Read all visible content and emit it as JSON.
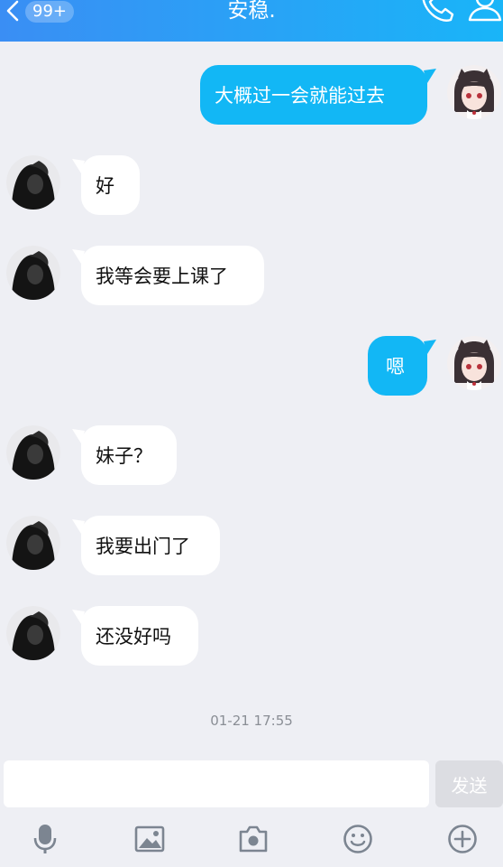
{
  "header": {
    "back_icon": "chevron-left-icon",
    "unread_badge": "99+",
    "title": "安稳.",
    "phone_icon": "phone-icon",
    "profile_icon": "user-profile-icon"
  },
  "messages": [
    {
      "side": "right",
      "text": "大概过一会就能过去"
    },
    {
      "side": "left",
      "text": "好"
    },
    {
      "side": "left",
      "text": "我等会要上课了"
    },
    {
      "side": "right",
      "text": "嗯"
    },
    {
      "side": "left",
      "text": "妹子？"
    },
    {
      "side": "left",
      "text": "我要出门了"
    },
    {
      "side": "left",
      "text": "还没好吗"
    }
  ],
  "timestamp": "01-21 17:55",
  "input": {
    "placeholder": "",
    "value": "",
    "send_label": "发送"
  },
  "toolbar": {
    "icons": [
      "microphone-icon",
      "image-icon",
      "camera-icon",
      "emoji-icon",
      "plus-icon"
    ]
  },
  "colors": {
    "header_start": "#3a8ef4",
    "header_end": "#19b5f8",
    "bubble_out": "#12b7f5",
    "bubble_in": "#ffffff",
    "background": "#eeeff4"
  }
}
